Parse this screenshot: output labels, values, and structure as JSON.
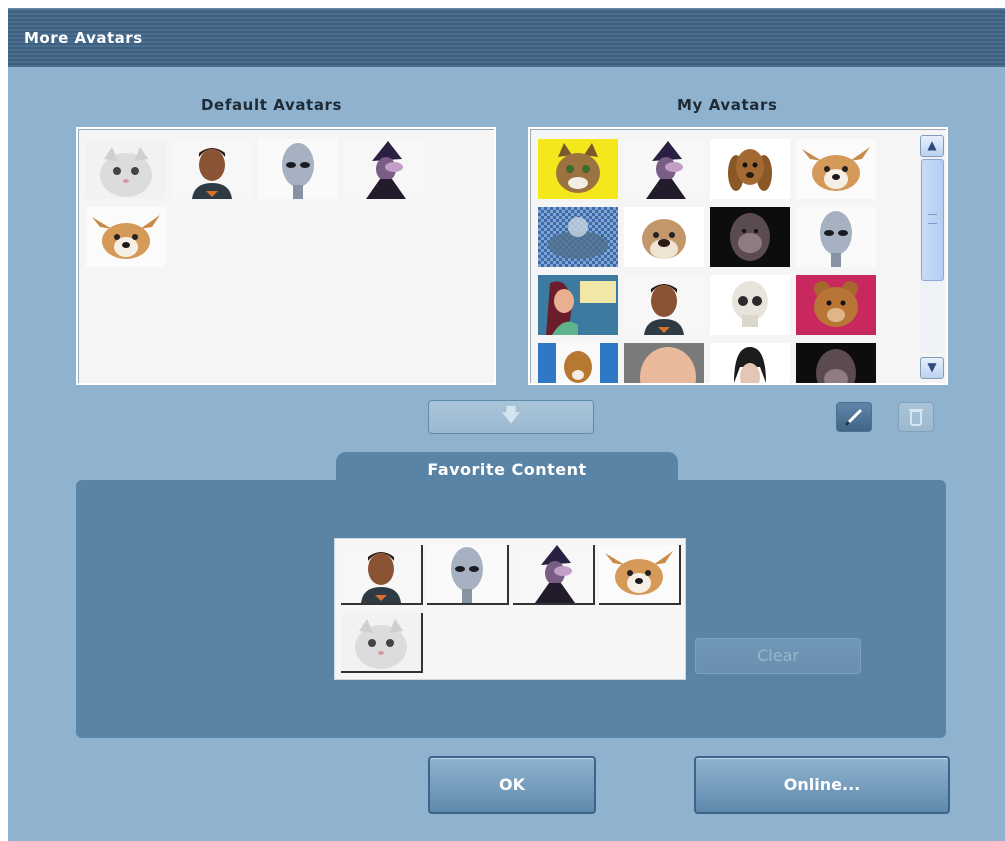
{
  "window": {
    "title": "More Avatars"
  },
  "default_avatars": {
    "heading": "Default Avatars",
    "items": [
      "kitten-avatar",
      "boy-avatar",
      "alien-avatar",
      "witch-avatar",
      "corgi-avatar"
    ]
  },
  "my_avatars": {
    "heading": "My Avatars",
    "items": [
      "cat-yellow-avatar",
      "witch-avatar",
      "spaniel-avatar",
      "corgi-avatar",
      "mesh-avatar",
      "bulldog-avatar",
      "gorilla-avatar",
      "alien-avatar",
      "woman-avatar",
      "boy-avatar",
      "skull-avatar",
      "teddy-bear-avatar",
      "beagle-avatar",
      "baby-avatar",
      "dark-hair-avatar",
      "gorilla-avatar"
    ]
  },
  "scrollbar": {
    "up_icon": "▲",
    "down_icon": "▼",
    "grip_icon": "≡"
  },
  "buttons": {
    "move_down": "🡇",
    "ok": "OK",
    "online": "Online...",
    "clear": "Clear"
  },
  "icons": {
    "edit": "edit-icon",
    "delete": "trash-icon"
  },
  "favorite": {
    "heading": "Favorite Content",
    "items": [
      "boy-avatar",
      "alien-avatar",
      "witch-avatar",
      "corgi-avatar",
      "kitten-avatar"
    ]
  }
}
